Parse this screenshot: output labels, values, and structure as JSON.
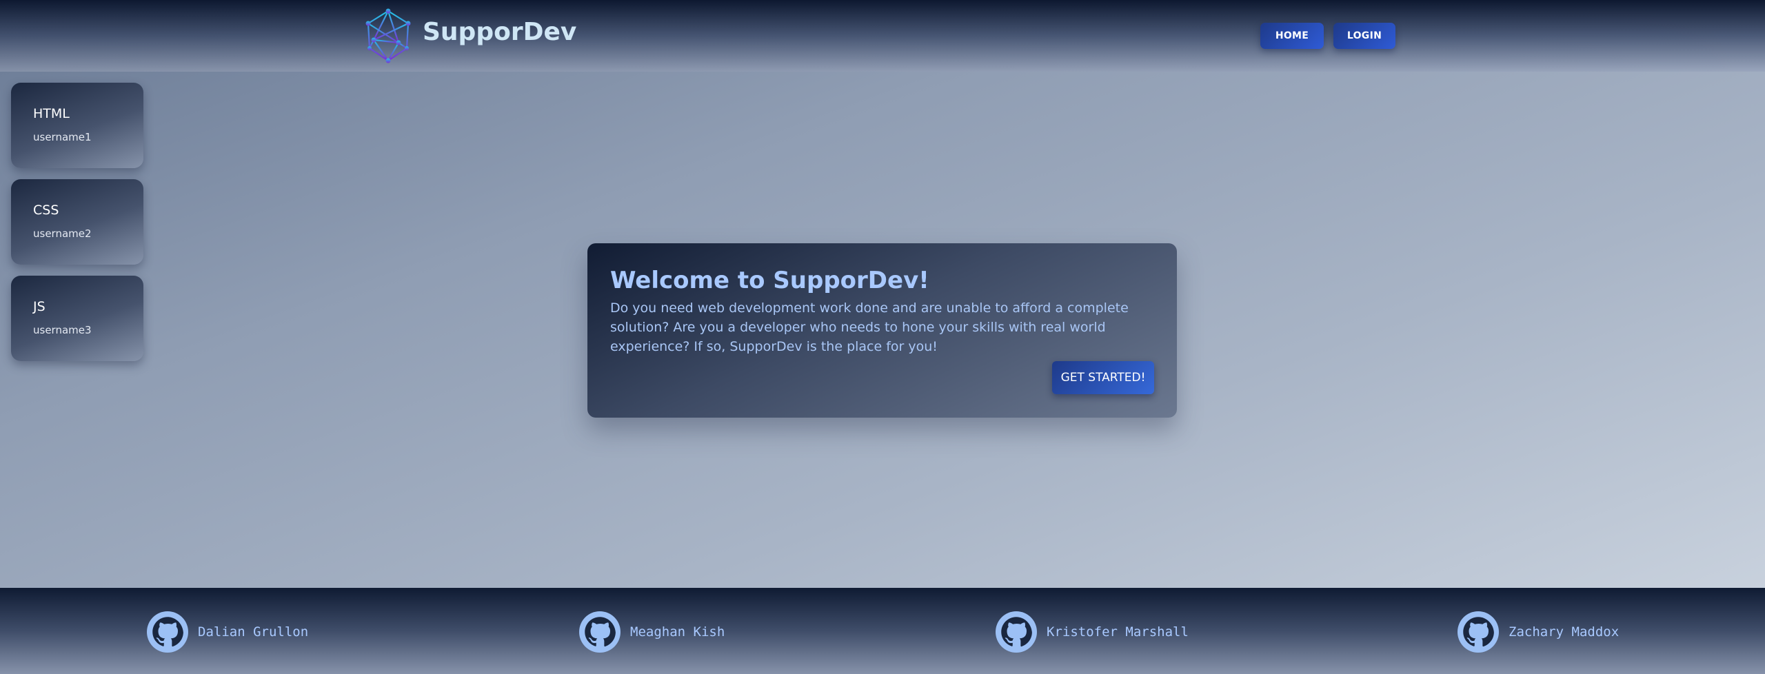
{
  "header": {
    "brand": "SupporDev",
    "logo_icon": "polyhedron-network-logo",
    "nav": {
      "home_label": "HOME",
      "login_label": "LOGIN"
    }
  },
  "sidebar": {
    "items": [
      {
        "title": "HTML",
        "username": "username1"
      },
      {
        "title": "CSS",
        "username": "username2"
      },
      {
        "title": "JS",
        "username": "username3"
      }
    ]
  },
  "welcome": {
    "title": "Welcome to SupporDev!",
    "body": "Do you need web development work done and are unable to afford a complete solution? Are you a developer who needs to hone your skills with real world experience? If so, SupporDev is the place for you!",
    "cta_label": "GET STARTED!"
  },
  "footer": {
    "icon": "github-icon",
    "credits": [
      {
        "name": "Dalian Grullon"
      },
      {
        "name": "Meaghan Kish"
      },
      {
        "name": "Kristofer Marshall"
      },
      {
        "name": "Zachary Maddox"
      }
    ]
  },
  "colors": {
    "accent_button": "#2f5bd6",
    "brand_text": "#cfe6f5",
    "link_text": "#a9c9ff"
  }
}
